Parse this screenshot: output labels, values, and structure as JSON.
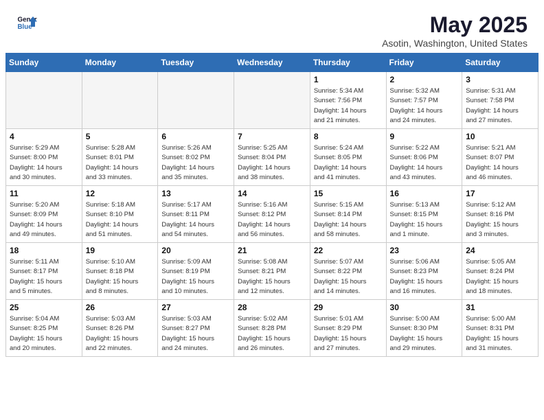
{
  "header": {
    "logo_line1": "General",
    "logo_line2": "Blue",
    "month_title": "May 2025",
    "location": "Asotin, Washington, United States"
  },
  "weekdays": [
    "Sunday",
    "Monday",
    "Tuesday",
    "Wednesday",
    "Thursday",
    "Friday",
    "Saturday"
  ],
  "weeks": [
    [
      {
        "day": "",
        "info": ""
      },
      {
        "day": "",
        "info": ""
      },
      {
        "day": "",
        "info": ""
      },
      {
        "day": "",
        "info": ""
      },
      {
        "day": "1",
        "info": "Sunrise: 5:34 AM\nSunset: 7:56 PM\nDaylight: 14 hours\nand 21 minutes."
      },
      {
        "day": "2",
        "info": "Sunrise: 5:32 AM\nSunset: 7:57 PM\nDaylight: 14 hours\nand 24 minutes."
      },
      {
        "day": "3",
        "info": "Sunrise: 5:31 AM\nSunset: 7:58 PM\nDaylight: 14 hours\nand 27 minutes."
      }
    ],
    [
      {
        "day": "4",
        "info": "Sunrise: 5:29 AM\nSunset: 8:00 PM\nDaylight: 14 hours\nand 30 minutes."
      },
      {
        "day": "5",
        "info": "Sunrise: 5:28 AM\nSunset: 8:01 PM\nDaylight: 14 hours\nand 33 minutes."
      },
      {
        "day": "6",
        "info": "Sunrise: 5:26 AM\nSunset: 8:02 PM\nDaylight: 14 hours\nand 35 minutes."
      },
      {
        "day": "7",
        "info": "Sunrise: 5:25 AM\nSunset: 8:04 PM\nDaylight: 14 hours\nand 38 minutes."
      },
      {
        "day": "8",
        "info": "Sunrise: 5:24 AM\nSunset: 8:05 PM\nDaylight: 14 hours\nand 41 minutes."
      },
      {
        "day": "9",
        "info": "Sunrise: 5:22 AM\nSunset: 8:06 PM\nDaylight: 14 hours\nand 43 minutes."
      },
      {
        "day": "10",
        "info": "Sunrise: 5:21 AM\nSunset: 8:07 PM\nDaylight: 14 hours\nand 46 minutes."
      }
    ],
    [
      {
        "day": "11",
        "info": "Sunrise: 5:20 AM\nSunset: 8:09 PM\nDaylight: 14 hours\nand 49 minutes."
      },
      {
        "day": "12",
        "info": "Sunrise: 5:18 AM\nSunset: 8:10 PM\nDaylight: 14 hours\nand 51 minutes."
      },
      {
        "day": "13",
        "info": "Sunrise: 5:17 AM\nSunset: 8:11 PM\nDaylight: 14 hours\nand 54 minutes."
      },
      {
        "day": "14",
        "info": "Sunrise: 5:16 AM\nSunset: 8:12 PM\nDaylight: 14 hours\nand 56 minutes."
      },
      {
        "day": "15",
        "info": "Sunrise: 5:15 AM\nSunset: 8:14 PM\nDaylight: 14 hours\nand 58 minutes."
      },
      {
        "day": "16",
        "info": "Sunrise: 5:13 AM\nSunset: 8:15 PM\nDaylight: 15 hours\nand 1 minute."
      },
      {
        "day": "17",
        "info": "Sunrise: 5:12 AM\nSunset: 8:16 PM\nDaylight: 15 hours\nand 3 minutes."
      }
    ],
    [
      {
        "day": "18",
        "info": "Sunrise: 5:11 AM\nSunset: 8:17 PM\nDaylight: 15 hours\nand 5 minutes."
      },
      {
        "day": "19",
        "info": "Sunrise: 5:10 AM\nSunset: 8:18 PM\nDaylight: 15 hours\nand 8 minutes."
      },
      {
        "day": "20",
        "info": "Sunrise: 5:09 AM\nSunset: 8:19 PM\nDaylight: 15 hours\nand 10 minutes."
      },
      {
        "day": "21",
        "info": "Sunrise: 5:08 AM\nSunset: 8:21 PM\nDaylight: 15 hours\nand 12 minutes."
      },
      {
        "day": "22",
        "info": "Sunrise: 5:07 AM\nSunset: 8:22 PM\nDaylight: 15 hours\nand 14 minutes."
      },
      {
        "day": "23",
        "info": "Sunrise: 5:06 AM\nSunset: 8:23 PM\nDaylight: 15 hours\nand 16 minutes."
      },
      {
        "day": "24",
        "info": "Sunrise: 5:05 AM\nSunset: 8:24 PM\nDaylight: 15 hours\nand 18 minutes."
      }
    ],
    [
      {
        "day": "25",
        "info": "Sunrise: 5:04 AM\nSunset: 8:25 PM\nDaylight: 15 hours\nand 20 minutes."
      },
      {
        "day": "26",
        "info": "Sunrise: 5:03 AM\nSunset: 8:26 PM\nDaylight: 15 hours\nand 22 minutes."
      },
      {
        "day": "27",
        "info": "Sunrise: 5:03 AM\nSunset: 8:27 PM\nDaylight: 15 hours\nand 24 minutes."
      },
      {
        "day": "28",
        "info": "Sunrise: 5:02 AM\nSunset: 8:28 PM\nDaylight: 15 hours\nand 26 minutes."
      },
      {
        "day": "29",
        "info": "Sunrise: 5:01 AM\nSunset: 8:29 PM\nDaylight: 15 hours\nand 27 minutes."
      },
      {
        "day": "30",
        "info": "Sunrise: 5:00 AM\nSunset: 8:30 PM\nDaylight: 15 hours\nand 29 minutes."
      },
      {
        "day": "31",
        "info": "Sunrise: 5:00 AM\nSunset: 8:31 PM\nDaylight: 15 hours\nand 31 minutes."
      }
    ]
  ]
}
